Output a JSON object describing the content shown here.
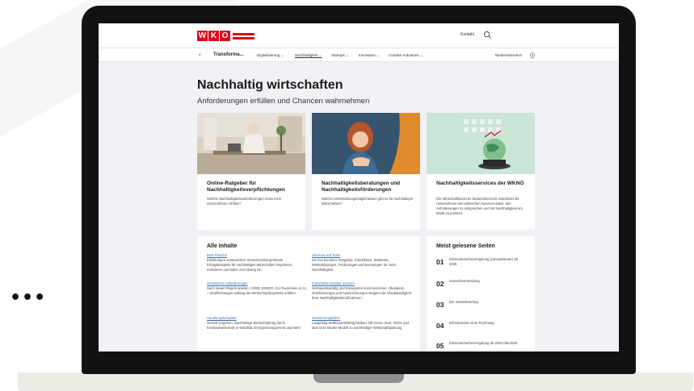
{
  "more_menu": "•••",
  "header": {
    "logo_letters": [
      "W",
      "K",
      "O"
    ],
    "contact": "Kontakt"
  },
  "nav": {
    "back": "‹",
    "title": "Transforma...",
    "items": [
      {
        "label": "Digitalisierung ⌄",
        "active": false
      },
      {
        "label": "Nachhaltigkeit ⌄",
        "active": true
      },
      {
        "label": "Startups ⌄",
        "active": false
      },
      {
        "label": "Innovation ⌄",
        "active": false
      },
      {
        "label": "Creative Industries ⌄",
        "active": false
      }
    ],
    "region": "Niederösterreich"
  },
  "hero": {
    "title": "Nachhaltig wirtschaften",
    "subtitle": "Anforderungen erfüllen und Chancen wahrnehmen"
  },
  "cards": [
    {
      "title": "Online-Ratgeber für Nachhaltigkeitsverpflichtungen",
      "text": "Welche Nachhaltigkeitsanforderungen muss mein Unternehmen erfüllen?"
    },
    {
      "title": "Nachhaltigkeitsberatungen und Nachhaltigkeitsförderungen",
      "text": "Welche Unterstützungsmöglichkeiten gibt es für nachhaltiges Wirtschaften?"
    },
    {
      "title": "Nachhaltigkeitsservices der WKNÖ",
      "text": "Die Wirtschaftskammer Niederösterreich unterstützt die Unternehmen mit zahlreichen Services dabei, den Anforderungen zu entsprechen und mit Nachhaltigkeit am Markt zu punkten."
    }
  ],
  "all_contents": {
    "title": "Alle Inhalte",
    "items": [
      {
        "link": "Best-Practice",
        "desc": "Erfahrungen austauschen: Branchenübergreifende Erfolgsbeispiele für nachhaltiges Wirtschaften inspirieren, motivieren und laden zum Dialog ein"
      },
      {
        "link": "Gesetzliche Anforderungen",
        "desc": "Nach neuen Regeln spielen: CSRD, ESEDG, EU-Taxonomie & Co – Verpflichtungen entlang der Wertschöpfungskette erfüllen"
      },
      {
        "link": "Handlungsbeispiele",
        "desc": "Gezielt vorgehen: Nachhaltige Wertschöpfung durch Kreislaufwirtschaft, E-Mobilität, Energiemanagement und mehr"
      },
      {
        "link": "Services und Tools",
        "desc": "Ins Tun kommen: Ratgeber, Checklisten, Webinare, Weiterbildungen, Förderungen und Beratungen für mehr Nachhaltigkeit"
      },
      {
        "link": "Fortschritte sichtbar machen",
        "desc": "Vertrauenswürdig und transparent kommunizieren: Ökolabels, Zertifizierungen und Auszeichnungen steigern die Glaubwürdigkeit Ihrer Nachhaltigkeitsmaßnahmen"
      },
      {
        "link": "Orientierungshilfen",
        "desc": "Langfristig wettbewerbsfähig bleiben: Mit Green Deal, SDGs und dem Drei-Säulen-Modell zu nachhaltiger Wirtschaftsplanung"
      }
    ]
  },
  "most_read": {
    "title": "Meist gelesene Seiten",
    "items": [
      {
        "num": "01",
        "label": "Kleinunternehmerregelung (Umsatzsteuer) ab 2025"
      },
      {
        "num": "02",
        "label": "Gewerbeanmeldung"
      },
      {
        "num": "03",
        "label": "Der Gewerbeertrag"
      },
      {
        "num": "04",
        "label": "Erfordernisse einer Rechnung"
      },
      {
        "num": "05",
        "label": "Kleinunternehmerregelung ab 2025 Übersicht"
      }
    ]
  },
  "colors": {
    "brand_red": "#e2001a",
    "link_blue": "#3a6fb0",
    "page_bg": "#f1f1f6",
    "card3_bg": "#c9e6d6"
  }
}
